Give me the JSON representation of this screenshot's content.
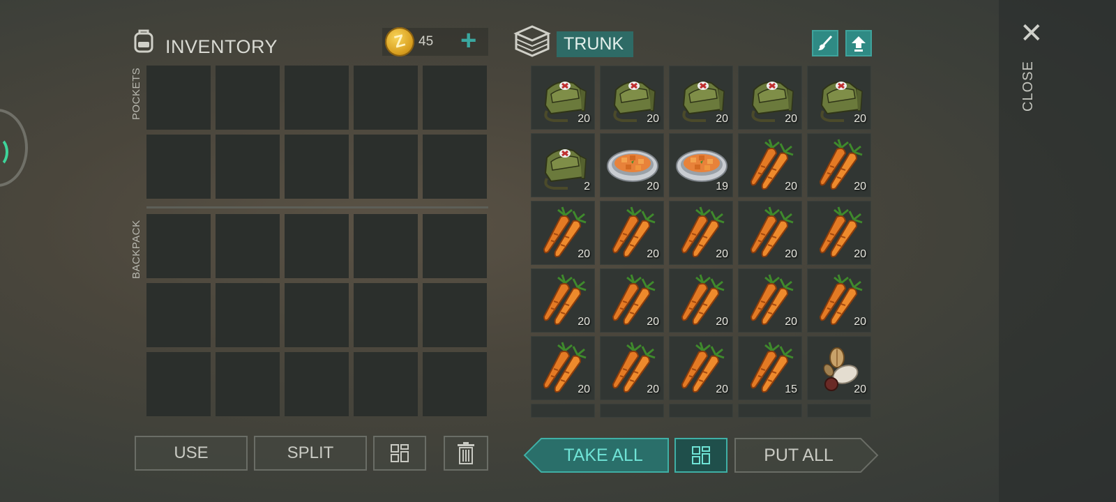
{
  "inventory": {
    "title": "INVENTORY",
    "coins": "45",
    "coin_symbol": "Z",
    "add_symbol": "+",
    "pockets_label": "POCKETS",
    "backpack_label": "BACKPACK"
  },
  "trunk": {
    "title": "TRUNK",
    "items": [
      {
        "icon": "medkit-bag-icon",
        "count": "20"
      },
      {
        "icon": "medkit-bag-icon",
        "count": "20"
      },
      {
        "icon": "medkit-bag-icon",
        "count": "20"
      },
      {
        "icon": "medkit-bag-icon",
        "count": "20"
      },
      {
        "icon": "medkit-bag-icon",
        "count": "20"
      },
      {
        "icon": "medkit-bag-icon",
        "count": "2"
      },
      {
        "icon": "carrot-stew-icon",
        "count": "20"
      },
      {
        "icon": "carrot-stew-icon",
        "count": "19"
      },
      {
        "icon": "carrot-icon",
        "count": "20"
      },
      {
        "icon": "carrot-icon",
        "count": "20"
      },
      {
        "icon": "carrot-icon",
        "count": "20"
      },
      {
        "icon": "carrot-icon",
        "count": "20"
      },
      {
        "icon": "carrot-icon",
        "count": "20"
      },
      {
        "icon": "carrot-icon",
        "count": "20"
      },
      {
        "icon": "carrot-icon",
        "count": "20"
      },
      {
        "icon": "carrot-icon",
        "count": "20"
      },
      {
        "icon": "carrot-icon",
        "count": "20"
      },
      {
        "icon": "carrot-icon",
        "count": "20"
      },
      {
        "icon": "carrot-icon",
        "count": "20"
      },
      {
        "icon": "carrot-icon",
        "count": "20"
      },
      {
        "icon": "carrot-icon",
        "count": "20"
      },
      {
        "icon": "carrot-icon",
        "count": "20"
      },
      {
        "icon": "carrot-icon",
        "count": "20"
      },
      {
        "icon": "carrot-icon",
        "count": "15"
      },
      {
        "icon": "seeds-icon",
        "count": "20"
      }
    ]
  },
  "buttons": {
    "use": "USE",
    "split": "SPLIT",
    "take_all": "TAKE ALL",
    "put_all": "PUT ALL"
  },
  "close": {
    "symbol": "✕",
    "label": "CLOSE"
  },
  "colors": {
    "accent": "#2f8a84",
    "slot": "#2b2f2c",
    "coin": "#e0aa28"
  }
}
